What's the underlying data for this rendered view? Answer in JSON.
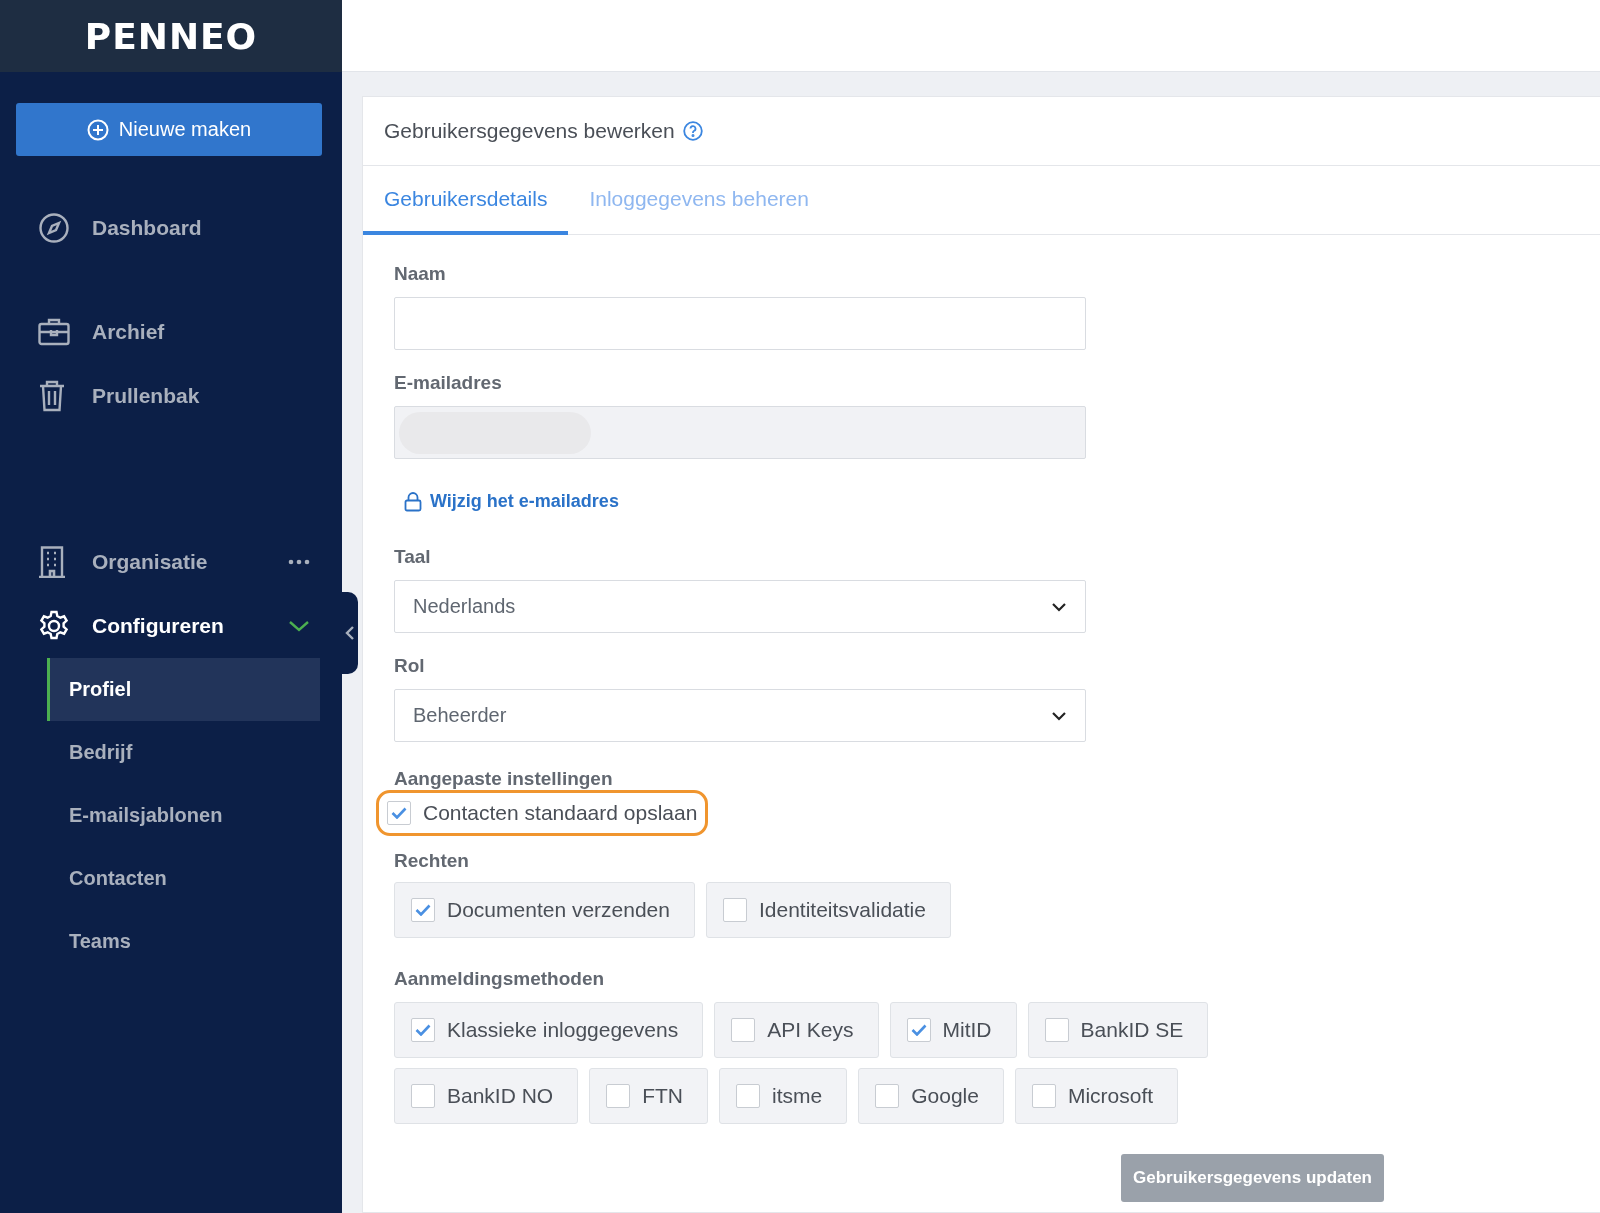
{
  "sidebar": {
    "logo": "PENNEO",
    "new_button": "Nieuwe maken",
    "groups": [
      [
        {
          "label": "Dashboard"
        }
      ],
      [
        {
          "label": "Archief"
        },
        {
          "label": "Prullenbak"
        }
      ],
      [
        {
          "label": "Organisatie",
          "more": true
        },
        {
          "label": "Configureren",
          "expanded": true,
          "children": [
            {
              "label": "Profiel",
              "selected": true
            },
            {
              "label": "Bedrijf",
              "selected": false
            },
            {
              "label": "E-mailsjablonen",
              "selected": false
            },
            {
              "label": "Contacten",
              "selected": false
            },
            {
              "label": "Teams",
              "selected": false
            }
          ]
        }
      ]
    ]
  },
  "card": {
    "title": "Gebruikersgegevens bewerken",
    "tabs": [
      {
        "label": "Gebruikersdetails",
        "selected": true
      },
      {
        "label": "Inloggegevens beheren",
        "selected": false
      }
    ],
    "name_label": "Naam",
    "email_label": "E-mailadres",
    "change_email_link": "Wijzig het e-mailadres",
    "language_label": "Taal",
    "language_value": "Nederlands",
    "role_label": "Rol",
    "role_value": "Beheerder",
    "custom_label": "Aangepaste instellingen",
    "custom_settings": [
      {
        "label": "Contacten standaard opslaan",
        "checked": true,
        "highlighted": true
      }
    ],
    "rights_label": "Rechten",
    "rights": [
      {
        "label": "Documenten verzenden",
        "checked": true
      },
      {
        "label": "Identiteitsvalidatie",
        "checked": false
      }
    ],
    "methods_label": "Aanmeldingsmethoden",
    "methods": [
      {
        "label": "Klassieke inloggegevens",
        "checked": true
      },
      {
        "label": "API Keys",
        "checked": false
      },
      {
        "label": "MitID",
        "checked": true
      },
      {
        "label": "BankID SE",
        "checked": false
      },
      {
        "label": "BankID NO",
        "checked": false
      },
      {
        "label": "FTN",
        "checked": false
      },
      {
        "label": "itsme",
        "checked": false
      },
      {
        "label": "Google",
        "checked": false
      },
      {
        "label": "Microsoft",
        "checked": false
      }
    ],
    "update_button": {
      "label": "Gebruikersgegevens updaten",
      "disabled": true
    }
  }
}
